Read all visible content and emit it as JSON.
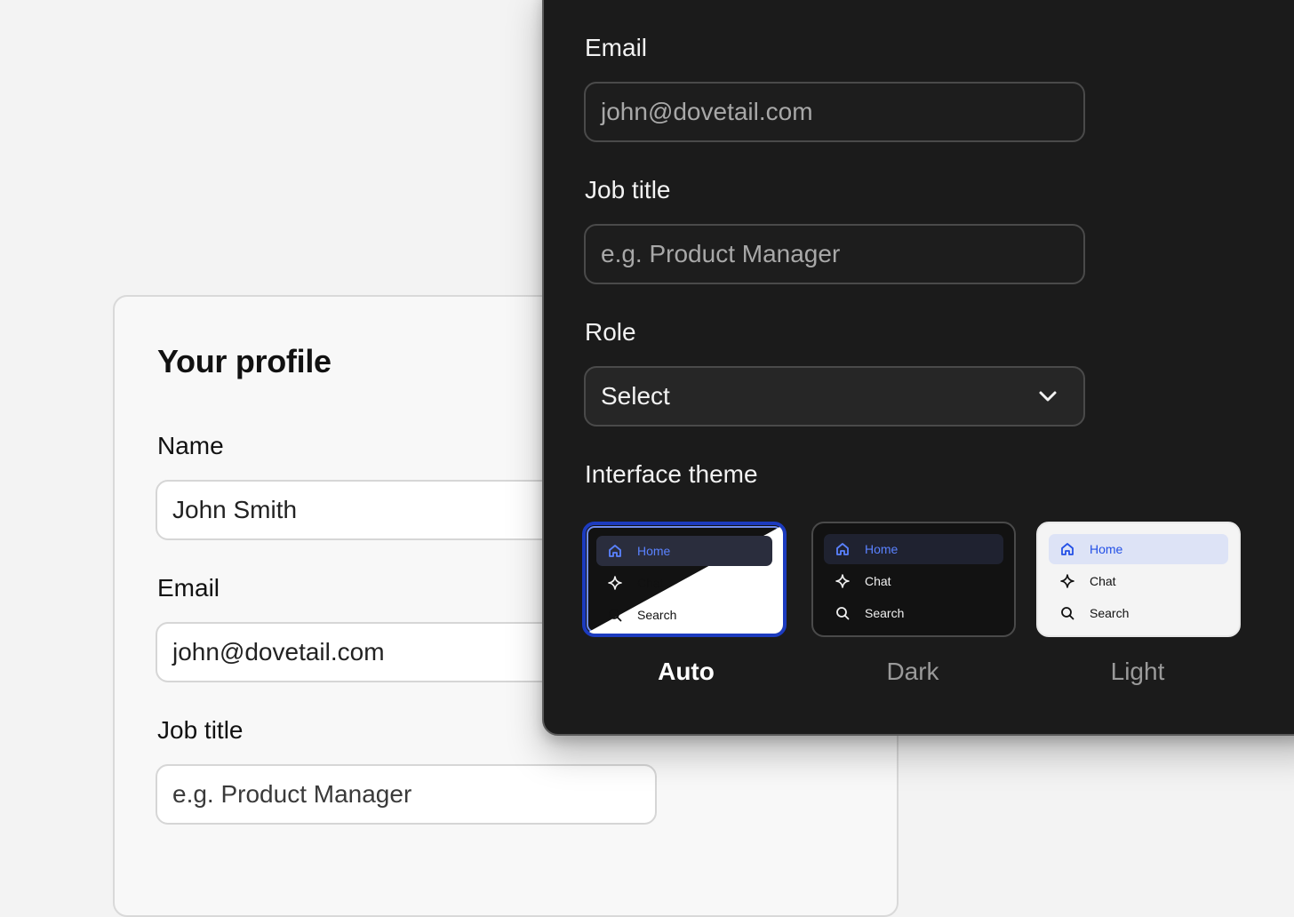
{
  "profile": {
    "title": "Your profile",
    "name_label": "Name",
    "name_value": "John Smith",
    "email_label": "Email",
    "email_value": "john@dovetail.com",
    "job_label": "Job title",
    "job_placeholder": "e.g. Product Manager"
  },
  "dark_form": {
    "email_label": "Email",
    "email_value": "john@dovetail.com",
    "job_label": "Job title",
    "job_placeholder": "e.g. Product Manager",
    "role_label": "Role",
    "role_value": "Select",
    "theme_label": "Interface theme"
  },
  "themes": [
    {
      "name": "Auto",
      "selected": true
    },
    {
      "name": "Dark",
      "selected": false
    },
    {
      "name": "Light",
      "selected": false
    }
  ],
  "preview_menu": [
    {
      "label": "Home",
      "icon": "home-icon"
    },
    {
      "label": "Chat",
      "icon": "sparkle-icon"
    },
    {
      "label": "Search",
      "icon": "search-icon"
    }
  ],
  "colors": {
    "accent": "#1c3bbf",
    "accent_text": "#2350e6",
    "dark_bg": "#1b1b1b",
    "light_bg": "#f8f8f8"
  }
}
